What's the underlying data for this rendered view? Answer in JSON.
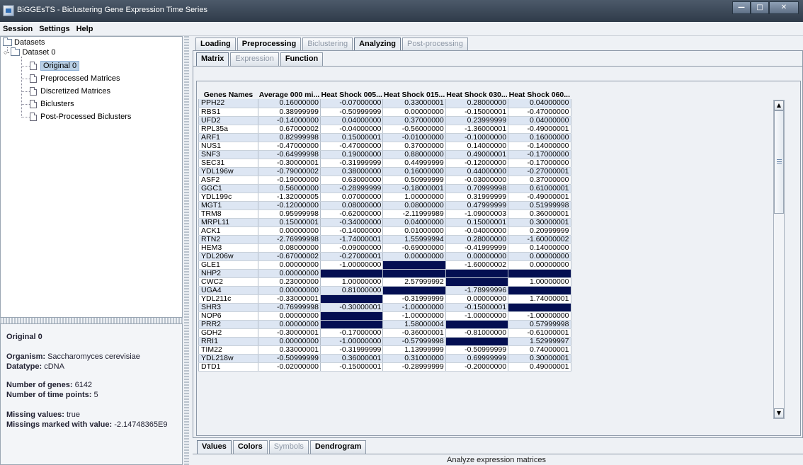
{
  "window": {
    "title": "BiGGEsTS - Biclustering Gene Expression Time Series"
  },
  "menu": [
    "Session",
    "Settings",
    "Help"
  ],
  "tree": {
    "root": "Datasets",
    "dataset": "Dataset 0",
    "items": [
      "Original 0",
      "Preprocessed Matrices",
      "Discretized Matrices",
      "Biclusters",
      "Post-Processed Biclusters"
    ],
    "selected": "Original 0"
  },
  "info": {
    "title": "Original 0",
    "organism_label": "Organism:",
    "organism": "Saccharomyces cerevisiae",
    "datatype_label": "Datatype:",
    "datatype": "cDNA",
    "genes_label": "Number of genes:",
    "genes": "6142",
    "timepoints_label": "Number of time points:",
    "timepoints": "5",
    "missing_label": "Missing values:",
    "missing": "true",
    "marked_label": "Missings marked with value:",
    "marked": "-2.14748365E9"
  },
  "main_tabs": [
    {
      "label": "Loading",
      "state": "normal"
    },
    {
      "label": "Preprocessing",
      "state": "normal"
    },
    {
      "label": "Biclustering",
      "state": "disabled"
    },
    {
      "label": "Analyzing",
      "state": "active"
    },
    {
      "label": "Post-processing",
      "state": "disabled"
    }
  ],
  "sub_tabs": [
    {
      "label": "Matrix",
      "state": "active"
    },
    {
      "label": "Expression",
      "state": "disabled"
    },
    {
      "label": "Function",
      "state": "normal"
    }
  ],
  "bottom_tabs": [
    {
      "label": "Values",
      "state": "active"
    },
    {
      "label": "Colors",
      "state": "normal"
    },
    {
      "label": "Symbols",
      "state": "disabled"
    },
    {
      "label": "Dendrogram",
      "state": "normal"
    }
  ],
  "table": {
    "columns": [
      "Genes Names",
      "Average 000 mi...",
      "Heat Shock 005...",
      "Heat Shock 015...",
      "Heat Shock 030...",
      "Heat Shock 060..."
    ],
    "missing_color": "#040f52",
    "rows": [
      [
        "PPH22",
        "0.16000000",
        "-0.07000000",
        "0.33000001",
        "0.28000000",
        "0.04000000"
      ],
      [
        "RBS1",
        "0.38999999",
        "-0.50999999",
        "0.00000000",
        "-0.15000001",
        "-0.47000000"
      ],
      [
        "UFD2",
        "-0.14000000",
        "0.04000000",
        "0.37000000",
        "0.23999999",
        "0.04000000"
      ],
      [
        "RPL35a",
        "0.67000002",
        "-0.04000000",
        "-0.56000000",
        "-1.36000001",
        "-0.49000001"
      ],
      [
        "ARF1",
        "0.82999998",
        "0.15000001",
        "-0.01000000",
        "-0.10000000",
        "0.16000000"
      ],
      [
        "NUS1",
        "-0.47000000",
        "-0.47000000",
        "0.37000000",
        "0.14000000",
        "-0.14000000"
      ],
      [
        "SNF3",
        "-0.64999998",
        "0.19000000",
        "0.88000000",
        "0.49000001",
        "-0.17000000"
      ],
      [
        "SEC31",
        "-0.30000001",
        "-0.31999999",
        "0.44999999",
        "-0.12000000",
        "-0.17000000"
      ],
      [
        "YDL196w",
        "-0.79000002",
        "0.38000000",
        "0.16000000",
        "0.44000000",
        "-0.27000001"
      ],
      [
        "ASF2",
        "-0.19000000",
        "0.63000000",
        "0.50999999",
        "-0.03000000",
        "0.37000000"
      ],
      [
        "GGC1",
        "0.56000000",
        "-0.28999999",
        "-0.18000001",
        "0.70999998",
        "0.61000001"
      ],
      [
        "YDL199c",
        "-1.32000005",
        "0.07000000",
        "1.00000000",
        "0.31999999",
        "-0.49000001"
      ],
      [
        "MGT1",
        "-0.12000000",
        "0.08000000",
        "0.08000000",
        "0.47999999",
        "0.51999998"
      ],
      [
        "TRM8",
        "0.95999998",
        "-0.62000000",
        "-2.11999989",
        "-1.09000003",
        "0.36000001"
      ],
      [
        "MRPL11",
        "0.15000001",
        "-0.34000000",
        "0.04000000",
        "0.15000001",
        "0.30000001"
      ],
      [
        "ACK1",
        "0.00000000",
        "-0.14000000",
        "0.01000000",
        "-0.04000000",
        "0.20999999"
      ],
      [
        "RTN2",
        "-2.76999998",
        "-1.74000001",
        "1.55999994",
        "0.28000000",
        "-1.60000002"
      ],
      [
        "HEM3",
        "0.08000000",
        "-0.09000000",
        "-0.69000000",
        "-0.41999999",
        "0.14000000"
      ],
      [
        "YDL206w",
        "-0.67000002",
        "-0.27000001",
        "0.00000000",
        "0.00000000",
        "0.00000000"
      ],
      [
        "GLE1",
        "0.00000000",
        "-1.00000000",
        "",
        "-1.60000002",
        "0.00000000"
      ],
      [
        "NHP2",
        "0.00000000",
        "",
        "",
        "",
        ""
      ],
      [
        "CWC2",
        "0.23000000",
        "1.00000000",
        "2.57999992",
        "",
        "1.00000000"
      ],
      [
        "UGA4",
        "0.00000000",
        "0.81000000",
        "",
        "-1.78999996",
        ""
      ],
      [
        "YDL211c",
        "-0.33000001",
        "",
        "-0.31999999",
        "0.00000000",
        "1.74000001"
      ],
      [
        "SHR3",
        "-0.76999998",
        "-0.30000001",
        "-1.00000000",
        "-0.15000001",
        ""
      ],
      [
        "NOP6",
        "0.00000000",
        "",
        "-1.00000000",
        "-1.00000000",
        "-1.00000000"
      ],
      [
        "PRR2",
        "0.00000000",
        "",
        "1.58000004",
        "",
        "0.57999998"
      ],
      [
        "GDH2",
        "-0.30000001",
        "-0.17000000",
        "-0.36000001",
        "-0.81000000",
        "-0.61000001"
      ],
      [
        "RRI1",
        "0.00000000",
        "-1.00000000",
        "-0.57999998",
        "",
        "1.52999997"
      ],
      [
        "TIM22",
        "0.33000001",
        "-0.31999999",
        "1.13999999",
        "-0.50999999",
        "0.74000001"
      ],
      [
        "YDL218w",
        "-0.50999999",
        "0.36000001",
        "0.31000000",
        "0.69999999",
        "0.30000001"
      ],
      [
        "DTD1",
        "-0.02000000",
        "-0.15000001",
        "-0.28999999",
        "-0.20000000",
        "0.49000001"
      ]
    ]
  },
  "status": "Analyze expression matrices"
}
